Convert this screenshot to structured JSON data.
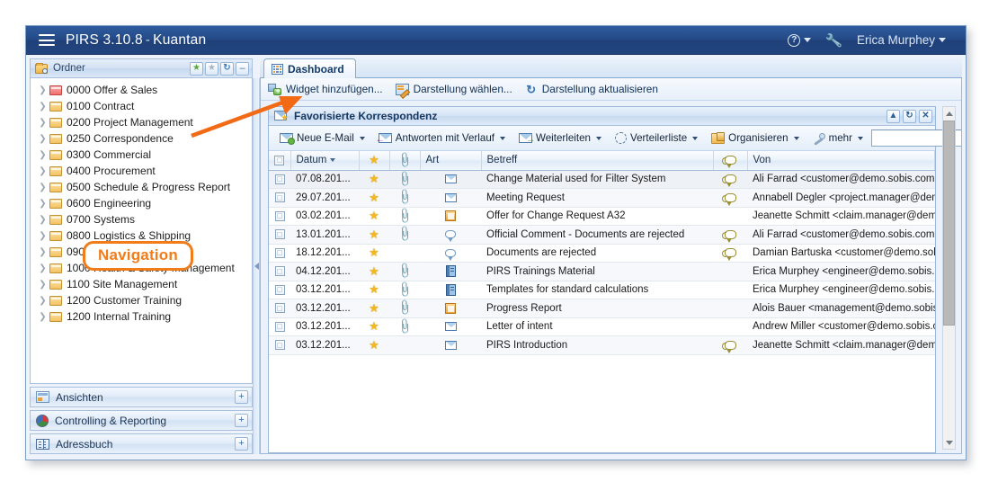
{
  "titlebar": {
    "menu_icon": "hamburger-icon",
    "app_name": "PIRS 3.10.8",
    "separator": "-",
    "project": "Kuantan",
    "help_icon": "question-mark-icon",
    "tools_icon": "wrench-icon",
    "user": "Erica Murphey"
  },
  "sidebar": {
    "header": {
      "title": "Ordner",
      "icon": "folder-search-icon",
      "buttons": [
        {
          "name": "favorite-on-button",
          "icon": "star-filled-green-icon",
          "glyph": "★"
        },
        {
          "name": "favorite-off-button",
          "icon": "star-outline-grey-icon",
          "glyph": "★"
        },
        {
          "name": "refresh-button",
          "icon": "refresh-icon",
          "glyph": "↻"
        },
        {
          "name": "collapse-button",
          "icon": "minus-icon",
          "glyph": "–"
        }
      ]
    },
    "tree": [
      {
        "label": "0000 Offer & Sales",
        "icon": "folder-red-icon"
      },
      {
        "label": "0100 Contract",
        "icon": "folder-icon"
      },
      {
        "label": "0200 Project Management",
        "icon": "folder-icon"
      },
      {
        "label": "0250 Correspondence",
        "icon": "folder-icon"
      },
      {
        "label": "0300 Commercial",
        "icon": "folder-icon"
      },
      {
        "label": "0400 Procurement",
        "icon": "folder-icon"
      },
      {
        "label": "0500 Schedule & Progress Report",
        "icon": "folder-icon"
      },
      {
        "label": "0600 Engineering",
        "icon": "folder-icon"
      },
      {
        "label": "0700 Systems",
        "icon": "folder-icon"
      },
      {
        "label": "0800 Logistics & Shipping",
        "icon": "folder-icon"
      },
      {
        "label": "0900 Quality Management",
        "icon": "folder-icon"
      },
      {
        "label": "1000 Health & Safety Management",
        "icon": "folder-icon"
      },
      {
        "label": "1100 Site Management",
        "icon": "folder-icon"
      },
      {
        "label": "1200 Customer Training",
        "icon": "folder-icon"
      },
      {
        "label": "1200 Internal Training",
        "icon": "folder-icon"
      }
    ],
    "callout": "Navigation",
    "callout_color": "#f07c1a",
    "sections": [
      {
        "label": "Ansichten",
        "icon": "views-icon",
        "expand": "+"
      },
      {
        "label": "Controlling & Reporting",
        "icon": "pie-chart-icon",
        "expand": "+"
      },
      {
        "label": "Adressbuch",
        "icon": "address-book-icon",
        "expand": "+"
      }
    ]
  },
  "tabs": [
    {
      "label": "Dashboard",
      "icon": "dashboard-grid-icon",
      "active": true
    }
  ],
  "dash_toolbar": [
    {
      "label": "Widget hinzufügen...",
      "icon": "add-widget-icon"
    },
    {
      "label": "Darstellung wählen...",
      "icon": "choose-layout-icon"
    },
    {
      "label": "Darstellung aktualisieren",
      "icon": "refresh-layout-icon"
    }
  ],
  "widget": {
    "title": "Favorisierte Korrespondenz",
    "title_icon": "mail-favorite-icon",
    "header_buttons": [
      {
        "name": "collapse-widget-button",
        "icon": "chevron-up-icon",
        "glyph": "▲"
      },
      {
        "name": "refresh-widget-button",
        "icon": "refresh-icon",
        "glyph": "↻"
      },
      {
        "name": "close-widget-button",
        "icon": "close-icon",
        "glyph": "✕"
      }
    ],
    "toolbar": [
      {
        "label": "Neue E-Mail",
        "icon": "new-email-icon",
        "dropdown": true
      },
      {
        "label": "Antworten mit Verlauf",
        "icon": "reply-with-history-icon",
        "dropdown": true
      },
      {
        "label": "Weiterleiten",
        "icon": "forward-icon",
        "dropdown": true
      },
      {
        "label": "Verteilerliste",
        "icon": "distribution-list-icon",
        "dropdown": true
      },
      {
        "label": "Organisieren",
        "icon": "organize-icon",
        "dropdown": true
      },
      {
        "label": "mehr",
        "icon": "more-wand-icon",
        "dropdown": true
      }
    ],
    "search": {
      "value": "",
      "placeholder": ""
    },
    "columns": [
      {
        "key": "check",
        "label": "",
        "icon": "checkbox-header-icon"
      },
      {
        "key": "datum",
        "label": "Datum",
        "sorted": "desc"
      },
      {
        "key": "star",
        "label": "",
        "icon": "star-header-icon"
      },
      {
        "key": "clip",
        "label": "",
        "icon": "paperclip-header-icon"
      },
      {
        "key": "art",
        "label": "Art"
      },
      {
        "key": "betreff",
        "label": "Betreff"
      },
      {
        "key": "comment",
        "label": "",
        "icon": "comment-header-icon"
      },
      {
        "key": "von",
        "label": "Von"
      }
    ],
    "rows": [
      {
        "datum": "07.08.201...",
        "star": true,
        "clip": true,
        "art": "envelope",
        "betreff": "Change Material used for Filter System",
        "comment": true,
        "von": "Ali Farrad <customer@demo.sobis.com>"
      },
      {
        "datum": "29.07.201...",
        "star": true,
        "clip": true,
        "art": "envelope",
        "betreff": "Meeting Request",
        "comment": true,
        "von": "Annabell Degler <project.manager@demo.sobi"
      },
      {
        "datum": "03.02.201...",
        "star": true,
        "clip": true,
        "art": "document",
        "betreff": "Offer for Change Request A32",
        "comment": false,
        "von": "Jeanette Schmitt <claim.manager@demo.sobis"
      },
      {
        "datum": "13.01.201...",
        "star": true,
        "clip": true,
        "art": "bubble",
        "betreff": "Official Comment - Documents are rejected",
        "comment": true,
        "von": "Ali Farrad <customer@demo.sobis.com>"
      },
      {
        "datum": "18.12.201...",
        "star": true,
        "clip": false,
        "art": "bubble",
        "betreff": "Documents are rejected",
        "comment": true,
        "von": "Damian Bartuska <customer@demo.sobis.com"
      },
      {
        "datum": "04.12.201...",
        "star": true,
        "clip": true,
        "art": "book",
        "betreff": "PIRS Trainings Material",
        "comment": false,
        "von": "Erica Murphey <engineer@demo.sobis.com>"
      },
      {
        "datum": "03.12.201...",
        "star": true,
        "clip": true,
        "art": "book",
        "betreff": "Templates for standard calculations",
        "comment": false,
        "von": "Erica Murphey <engineer@demo.sobis.com>"
      },
      {
        "datum": "03.12.201...",
        "star": true,
        "clip": true,
        "art": "document",
        "betreff": "Progress Report",
        "comment": false,
        "von": "Alois Bauer <management@demo.sobis.com>"
      },
      {
        "datum": "03.12.201...",
        "star": true,
        "clip": true,
        "art": "envelope",
        "betreff": "Letter of intent",
        "comment": false,
        "von": "Andrew Miller <customer@demo.sobis.com>"
      },
      {
        "datum": "03.12.201...",
        "star": true,
        "clip": false,
        "art": "envelope",
        "betreff": "PIRS Introduction",
        "comment": true,
        "von": "Jeanette Schmitt <claim.manager@demo.sobis"
      }
    ]
  },
  "scrollbar": {
    "up": "▲",
    "down": "▼"
  },
  "colors": {
    "title_bar": "#24497f",
    "accent_orange": "#f07c1a",
    "panel_border": "#9bb8d8",
    "star_yellow": "#f2b721"
  }
}
